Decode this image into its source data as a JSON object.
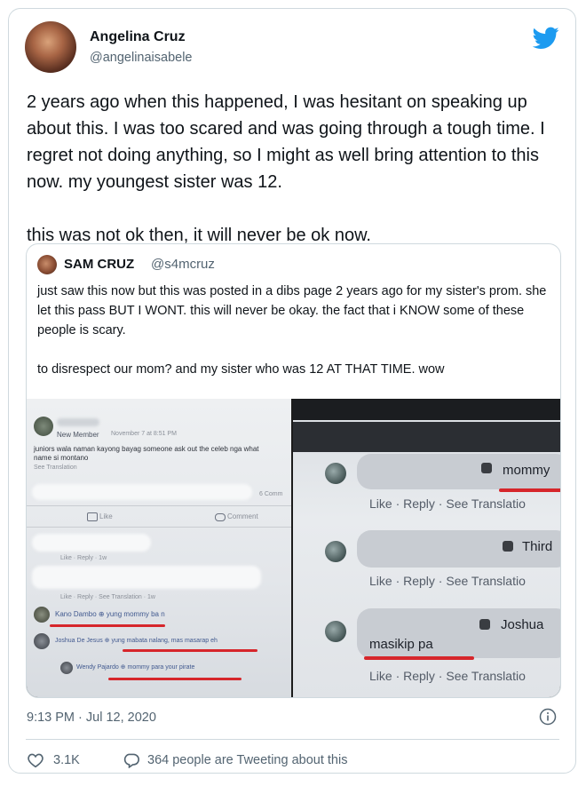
{
  "author": {
    "name": "Angelina Cruz",
    "handle": "@angelinaisabele"
  },
  "tweet": {
    "paragraph1": "2 years ago when this happened, I was hesitant on speaking up about this. I was too scared and was going through a tough time. I regret not doing anything, so I might as well bring attention to this now. my youngest sister was 12.",
    "paragraph2": "this was not ok then, it will never be ok now."
  },
  "quoted": {
    "name": "SAM CRUZ",
    "handle": "@s4mcruz",
    "paragraph1": "just saw this now but this was posted in a dibs page 2 years ago for my sister's prom. she let this pass BUT I WONT. this will never be okay. the fact that i KNOW some of these people is scary.",
    "paragraph2": "to disrespect our mom? and my sister who was 12 AT THAT TIME. wow"
  },
  "left_screenshot": {
    "member_badge": "New Member",
    "post_time": "November 7 at 8:51 PM",
    "post_text_line1": "juniors wala naman kayong bayag someone ask out the celeb nga what",
    "post_text_line2": "name si montano",
    "see_translation": "See Translation",
    "comments_count": "6 Comm",
    "like_label": "Like",
    "comment_label": "Comment",
    "actions_small": "Like · Reply · 1w",
    "actions_small2": "Like · Reply · See Translation · 1w",
    "comment1": "Kano Dambo ⊕ yung mommy ba n",
    "comment2": "Joshua De Jesus ⊕ yung mabata nalang, mas masarap eh",
    "comment3": "Wendy Pajardo ⊕ mommy para your pirate"
  },
  "right_screenshot": {
    "comment1_tail": "mommy",
    "comment2_tail": "Third",
    "comment3_name": "Joshua",
    "comment3_text": "masikip pa",
    "actions": "Like · Reply · See Translatio"
  },
  "meta": {
    "timestamp": "9:13 PM · Jul 12, 2020",
    "likes": "3.1K",
    "tweeting": "364 people are Tweeting about this"
  },
  "colors": {
    "twitter_blue": "#1d9bf0",
    "secondary_text": "#536471",
    "border": "#cfd9de",
    "annotation_red": "#d6262b"
  },
  "icons": [
    "twitter-bird-icon",
    "info-icon",
    "heart-icon",
    "reply-bubble-icon",
    "globe-icon"
  ]
}
